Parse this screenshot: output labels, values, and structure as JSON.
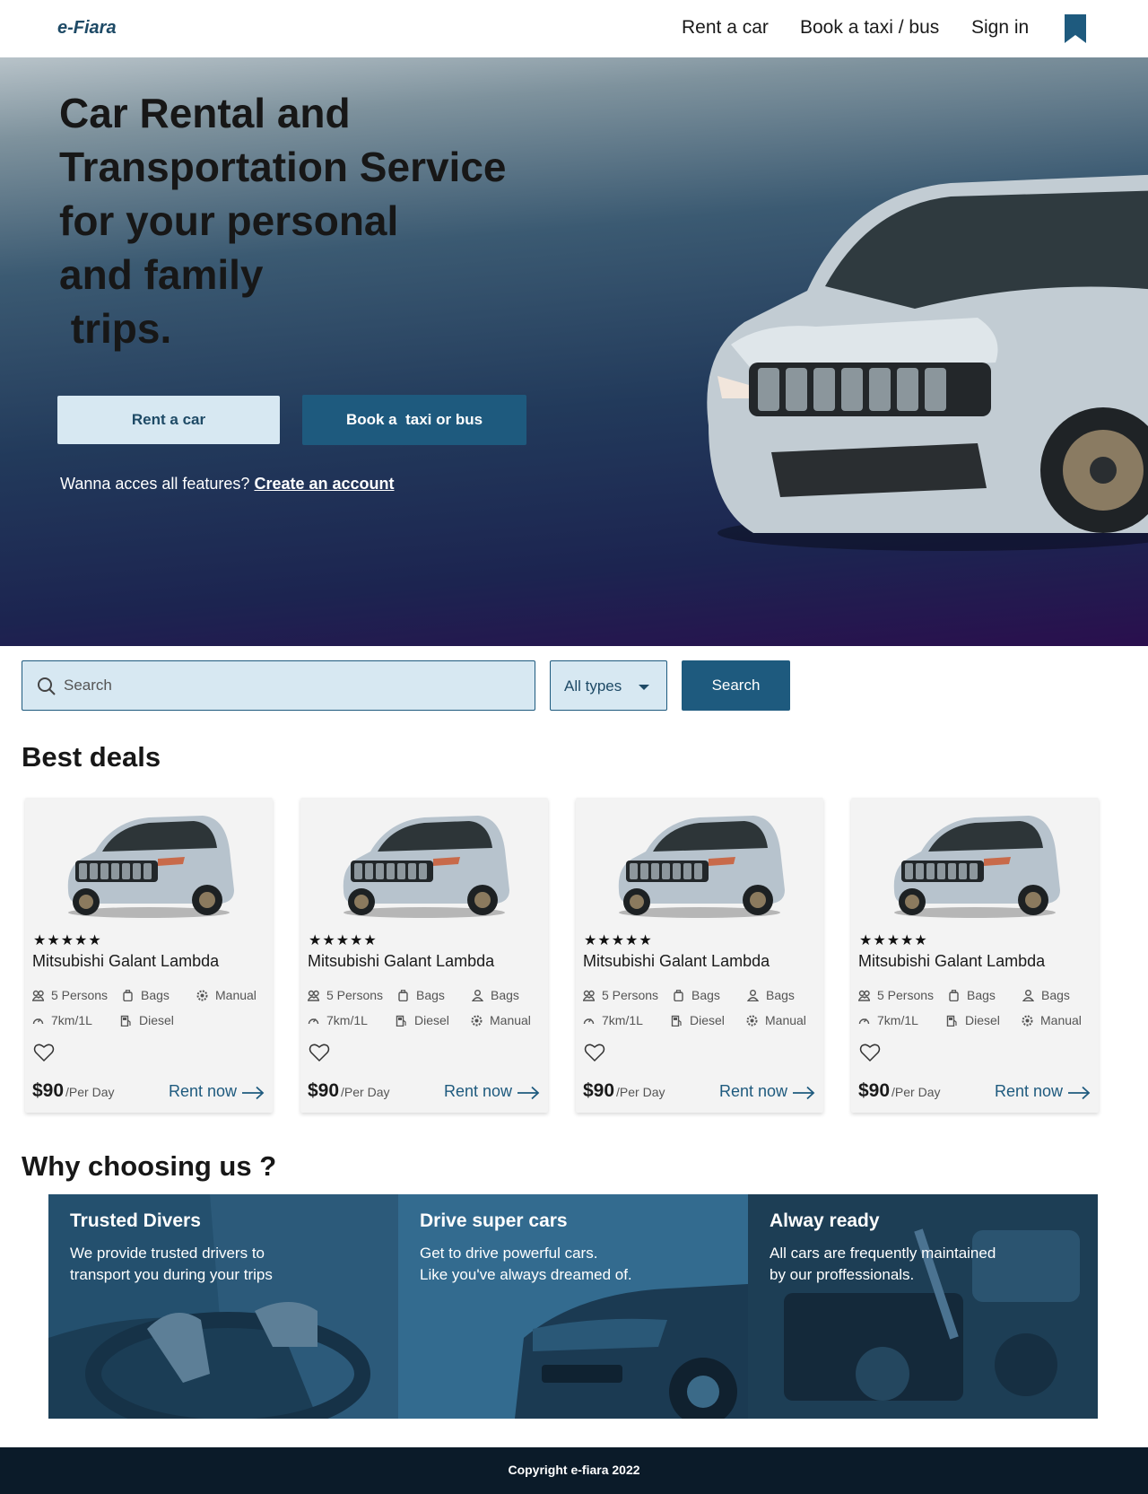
{
  "nav": {
    "logo": "e-Fiara",
    "links": [
      "Rent a car",
      "Book a taxi / bus",
      "Sign in"
    ],
    "bookmark_icon": "bookmark-icon"
  },
  "hero": {
    "title_lines": [
      "Car Rental and",
      "Transportation Service",
      "for your personal",
      "and family",
      " trips."
    ],
    "rent_button": "Rent a car",
    "book_button": "Book a  taxi or bus",
    "cta_text": "Wanna acces all features?",
    "cta_link": "Create an account"
  },
  "search": {
    "placeholder": "Search",
    "type_select": "All types",
    "button": "Search"
  },
  "deals": {
    "title": "Best deals",
    "cards": [
      {
        "rating": "★★★★★",
        "name": "Mitsubishi Galant Lambda",
        "specs": [
          {
            "icon": "people-icon",
            "label": "5 Persons"
          },
          {
            "icon": "bag-icon",
            "label": "Bags"
          },
          {
            "icon": "gear-icon",
            "label": "Manual"
          },
          {
            "icon": "speedometer-icon",
            "label": "7km/1L"
          },
          {
            "icon": "fuel-icon",
            "label": "Diesel"
          }
        ],
        "price": "$90",
        "per": "/Per Day",
        "cta": "Rent now"
      },
      {
        "rating": "★★★★★",
        "name": "Mitsubishi Galant Lambda",
        "specs": [
          {
            "icon": "people-icon",
            "label": "5 Persons"
          },
          {
            "icon": "bag-icon",
            "label": "Bags"
          },
          {
            "icon": "person-icon",
            "label": "Bags"
          },
          {
            "icon": "speedometer-icon",
            "label": "7km/1L"
          },
          {
            "icon": "fuel-icon",
            "label": "Diesel"
          },
          {
            "icon": "gear-icon",
            "label": "Manual"
          }
        ],
        "price": "$90",
        "per": "/Per Day",
        "cta": "Rent now"
      },
      {
        "rating": "★★★★★",
        "name": "Mitsubishi Galant Lambda",
        "specs": [
          {
            "icon": "people-icon",
            "label": "5 Persons"
          },
          {
            "icon": "bag-icon",
            "label": "Bags"
          },
          {
            "icon": "person-icon",
            "label": "Bags"
          },
          {
            "icon": "speedometer-icon",
            "label": "7km/1L"
          },
          {
            "icon": "fuel-icon",
            "label": "Diesel"
          },
          {
            "icon": "gear-icon",
            "label": "Manual"
          }
        ],
        "price": "$90",
        "per": "/Per Day",
        "cta": "Rent now"
      },
      {
        "rating": "★★★★★",
        "name": "Mitsubishi Galant Lambda",
        "specs": [
          {
            "icon": "people-icon",
            "label": "5 Persons"
          },
          {
            "icon": "bag-icon",
            "label": "Bags"
          },
          {
            "icon": "person-icon",
            "label": "Bags"
          },
          {
            "icon": "speedometer-icon",
            "label": "7km/1L"
          },
          {
            "icon": "fuel-icon",
            "label": "Diesel"
          },
          {
            "icon": "gear-icon",
            "label": "Manual"
          }
        ],
        "price": "$90",
        "per": "/Per Day",
        "cta": "Rent now"
      }
    ]
  },
  "why": {
    "title": "Why choosing us ?",
    "items": [
      {
        "heading": "Trusted Divers",
        "text": "We provide trusted drivers to\ntransport  you during your trips"
      },
      {
        "heading": "Drive super cars",
        "text": "Get to drive powerful cars.\nLike you've always dreamed of."
      },
      {
        "heading": "Alway ready",
        "text": "All cars are frequently maintained\nby our proffessionals."
      }
    ]
  },
  "footer": {
    "text": "Copyright e-fiara 2022"
  },
  "colors": {
    "primary": "#1e5a7e",
    "light": "#d7e8f2",
    "footer": "#0b1b29"
  }
}
